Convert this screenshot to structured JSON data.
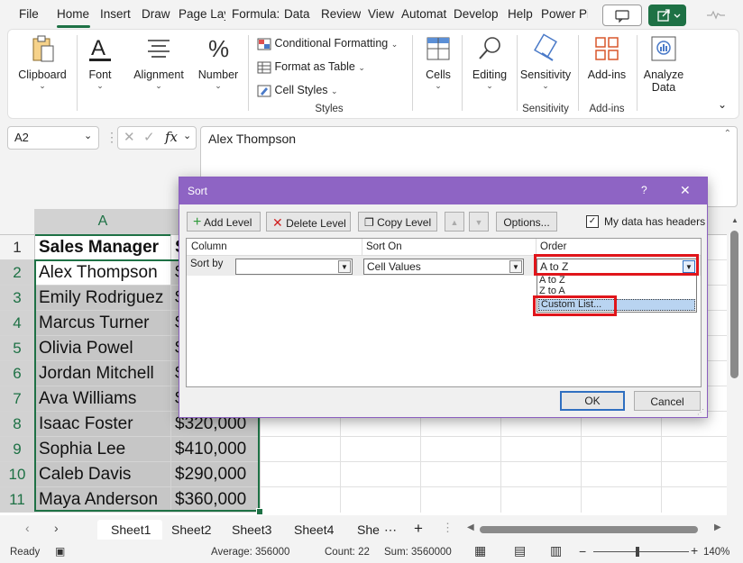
{
  "menu": {
    "tabs": [
      "File",
      "Home",
      "Insert",
      "Draw",
      "Page Layout",
      "Formulas",
      "Data",
      "Review",
      "View",
      "Automate",
      "Developer",
      "Help",
      "Power Pivot"
    ],
    "tabs_display": [
      "File",
      "Home",
      "Insert",
      "Draw",
      "Page Lay",
      "Formula:",
      "Data",
      "Review",
      "View",
      "Automat",
      "Develop",
      "Help",
      "Power Pi"
    ],
    "active": "Home"
  },
  "ribbon": {
    "clipboard": "Clipboard",
    "font": "Font",
    "alignment": "Alignment",
    "number": "Number",
    "conditional_formatting": "Conditional Formatting",
    "format_as_table": "Format as Table",
    "cell_styles": "Cell Styles",
    "styles_group": "Styles",
    "cells": "Cells",
    "editing": "Editing",
    "sensitivity": "Sensitivity",
    "sensitivity_group": "Sensitivity",
    "add_ins": "Add-ins",
    "add_ins_group": "Add-ins",
    "analyze_data_line1": "Analyze",
    "analyze_data_line2": "Data"
  },
  "formula_bar": {
    "name_box": "A2",
    "fx": "fx",
    "content": "Alex Thompson"
  },
  "grid": {
    "col_a": "A",
    "col_b_partial": "S",
    "rows": [
      "1",
      "2",
      "3",
      "4",
      "5",
      "6",
      "7",
      "8",
      "9",
      "10",
      "11"
    ],
    "header": "Sales Manager",
    "names": [
      "Alex Thompson",
      "Emily Rodriguez",
      "Marcus Turner",
      "Olivia Powel",
      "Jordan Mitchell",
      "Ava Williams",
      "Isaac Foster",
      "Sophia Lee",
      "Caleb Davis",
      "Maya Anderson"
    ],
    "sales_visible": [
      "$320,000",
      "$410,000",
      "$290,000",
      "$360,000"
    ],
    "sales_partial": [
      "$",
      "$",
      "$",
      "$",
      "$",
      "$"
    ]
  },
  "dialog": {
    "title": "Sort",
    "help": "?",
    "close": "✕",
    "add_level": "Add Level",
    "delete_level": "Delete Level",
    "copy_level": "Copy Level",
    "options": "Options...",
    "my_data_has_headers": "My data has headers",
    "headers_checked": true,
    "col_column": "Column",
    "col_sort_on": "Sort On",
    "col_order": "Order",
    "sort_by": "Sort by",
    "sort_by_value": "",
    "sort_on_value": "Cell Values",
    "order_value": "A to Z",
    "order_options": [
      "A to Z",
      "Z to A",
      "Custom List..."
    ],
    "ok": "OK",
    "cancel": "Cancel"
  },
  "sheets": {
    "tabs": [
      "Sheet1",
      "Sheet2",
      "Sheet3",
      "Sheet4",
      "She"
    ],
    "more": "⋯",
    "add": "+"
  },
  "status": {
    "ready": "Ready",
    "average": "Average: 356000",
    "count": "Count: 22",
    "sum": "Sum: 3560000",
    "zoom": "140%"
  },
  "colors": {
    "accent": "#1e7145",
    "dialog_title": "#8e64c4",
    "highlight": "#e0151b",
    "selection": "#c6c6c6"
  }
}
